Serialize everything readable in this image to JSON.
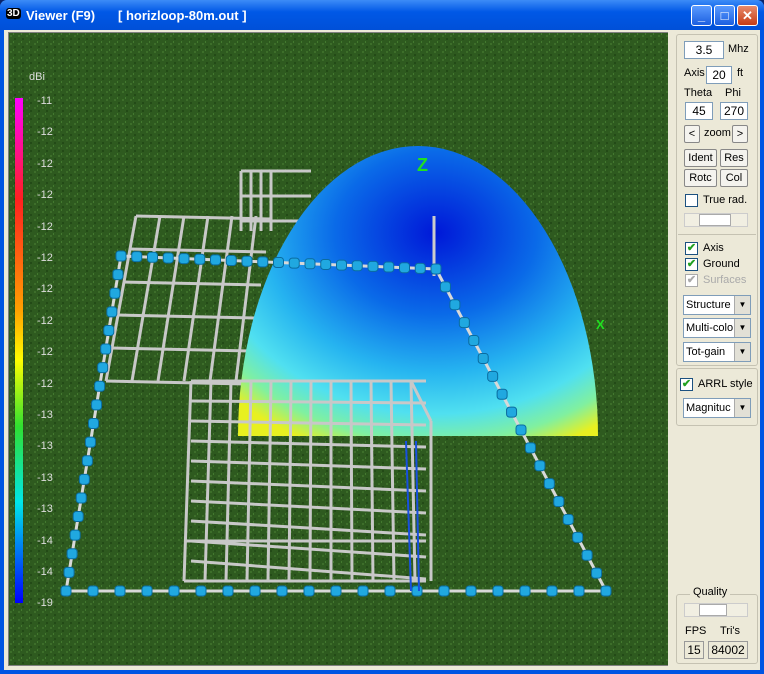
{
  "window": {
    "icon": "3D",
    "title": "Viewer (F9)",
    "file": "[  horizloop-80m.out ]",
    "minimize": "_",
    "maximize": "□",
    "close": "✕"
  },
  "controls": {
    "freq": "3.5",
    "freq_unit": "Mhz",
    "axis_label": "Axis",
    "axis_value": "20",
    "axis_unit": "ft",
    "theta_label": "Theta",
    "phi_label": "Phi",
    "theta": "45",
    "phi": "270",
    "zoom_prev": "<",
    "zoom_label": "zoom",
    "zoom_next": ">",
    "ident": "Ident",
    "res": "Res",
    "rotc": "Rotc",
    "col": "Col",
    "true_rad": "True rad.",
    "true_rad_checked": false,
    "axis_cb": "Axis",
    "axis_checked": true,
    "ground_cb": "Ground",
    "ground_checked": true,
    "surfaces_cb": "Surfaces",
    "surfaces_checked": true,
    "display": "Structure",
    "color": "Multi-colo",
    "gain": "Tot-gain",
    "arrl": "ARRL style",
    "arrl_checked": true,
    "mode": "Magnituc"
  },
  "quality": {
    "label": "Quality",
    "fps_label": "FPS",
    "tris_label": "Tri's",
    "fps": "15",
    "tris": "84002"
  },
  "legend": {
    "unit": "dBi",
    "values": [
      "-11",
      "-12",
      "-12",
      "-12",
      "-12",
      "-12",
      "-12",
      "-12",
      "-12",
      "-12",
      "-13",
      "-13",
      "-13",
      "-13",
      "-14",
      "-14",
      "-19"
    ]
  },
  "axes": {
    "z": "Z",
    "x": "X"
  }
}
